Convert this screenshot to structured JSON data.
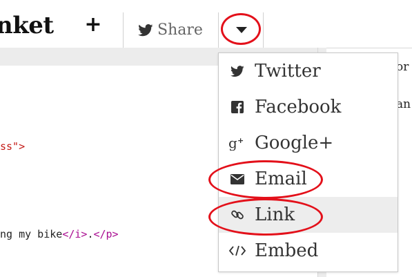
{
  "app": {
    "title": "nket"
  },
  "toolbar": {
    "plus_label": "+",
    "share_label": "Share",
    "caret_icon": "caret-down-icon"
  },
  "editor": {
    "line1": {
      "text": "ss\">"
    },
    "line2": {
      "prefix": "ng my bike",
      "tag1": "</i>",
      "dot": ".",
      "tag2": "</p>"
    }
  },
  "preview": {
    "line1": "or",
    "line2": "an"
  },
  "dropdown": {
    "items": [
      {
        "label": "Twitter",
        "icon": "twitter-icon"
      },
      {
        "label": "Facebook",
        "icon": "facebook-icon"
      },
      {
        "label": "Google+",
        "icon": "google-plus-icon"
      },
      {
        "label": "Email",
        "icon": "envelope-icon"
      },
      {
        "label": "Link",
        "icon": "link-icon"
      },
      {
        "label": "Embed",
        "icon": "code-icon"
      }
    ]
  },
  "colors": {
    "annotation": "#e3101a",
    "code_string": "#c41a16",
    "code_tag": "#aa0d91",
    "code_text": "#222222"
  }
}
